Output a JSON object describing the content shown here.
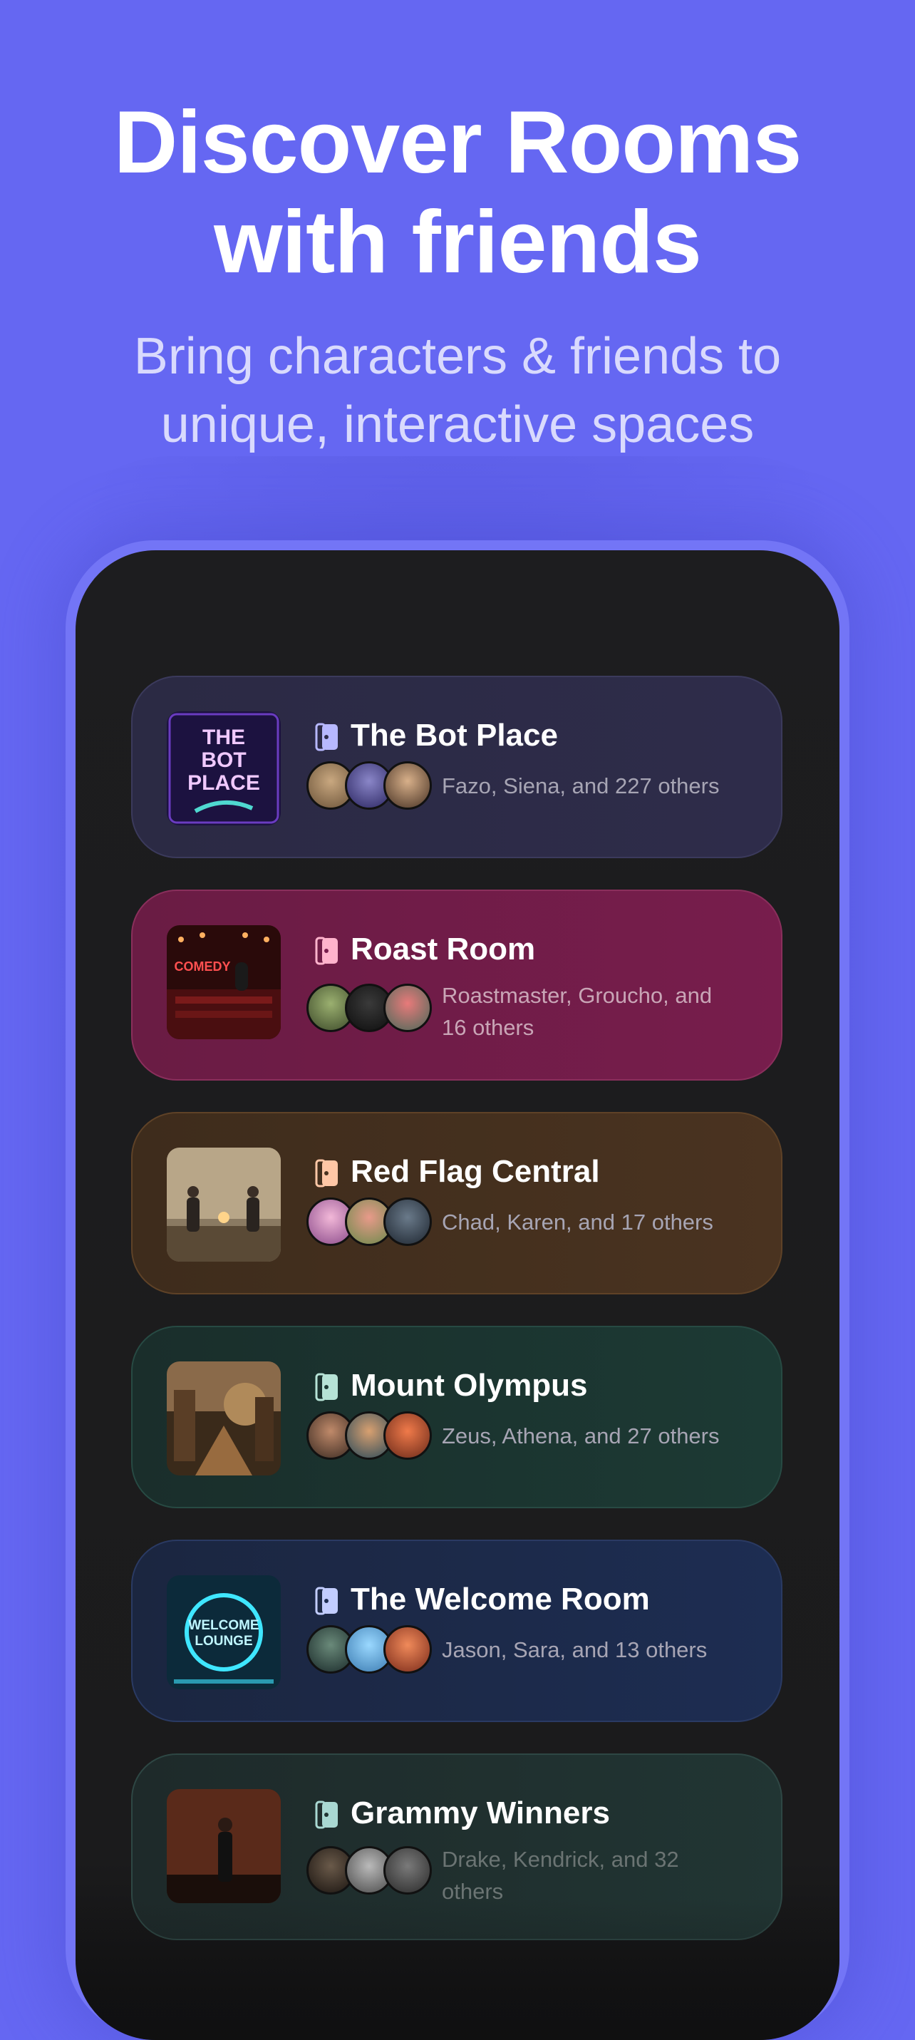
{
  "header": {
    "title_line1": "Discover Rooms",
    "title_line2": "with friends",
    "subtitle_line1": "Bring characters & friends to",
    "subtitle_line2": "unique, interactive spaces"
  },
  "colors": {
    "background": "#6567f2",
    "phone_frame": "#7375f6",
    "screen": "#1d1d1f"
  },
  "rooms": [
    {
      "title": "The Bot Place",
      "members_line1": "Fazo, Siena, and 227 others",
      "members_line2": "",
      "thumb_text": [
        "THE",
        "BOT",
        "PLACE"
      ],
      "color": "#2e2c4a"
    },
    {
      "title": "Roast Room",
      "members_line1": "Roastmaster, Groucho, and",
      "members_line2": "16 others",
      "thumb_text": [
        "COMEDY"
      ],
      "color": "#771d4c"
    },
    {
      "title": "Red Flag Central",
      "members_line1": "Chad, Karen, and 17 others",
      "members_line2": "",
      "color": "#4a3320"
    },
    {
      "title": "Mount Olympus",
      "members_line1": "Zeus, Athena, and 27 others",
      "members_line2": "",
      "color": "#1c3a34"
    },
    {
      "title": "The Welcome Room",
      "members_line1": "Jason, Sara, and 13 others",
      "members_line2": "",
      "thumb_text": [
        "WELCOME",
        "LOUNGE"
      ],
      "color": "#1d2d52"
    },
    {
      "title": "Grammy Winners",
      "members_line1": "Drake, Kendrick, and 32",
      "members_line2": "others",
      "color": "#213533"
    }
  ]
}
